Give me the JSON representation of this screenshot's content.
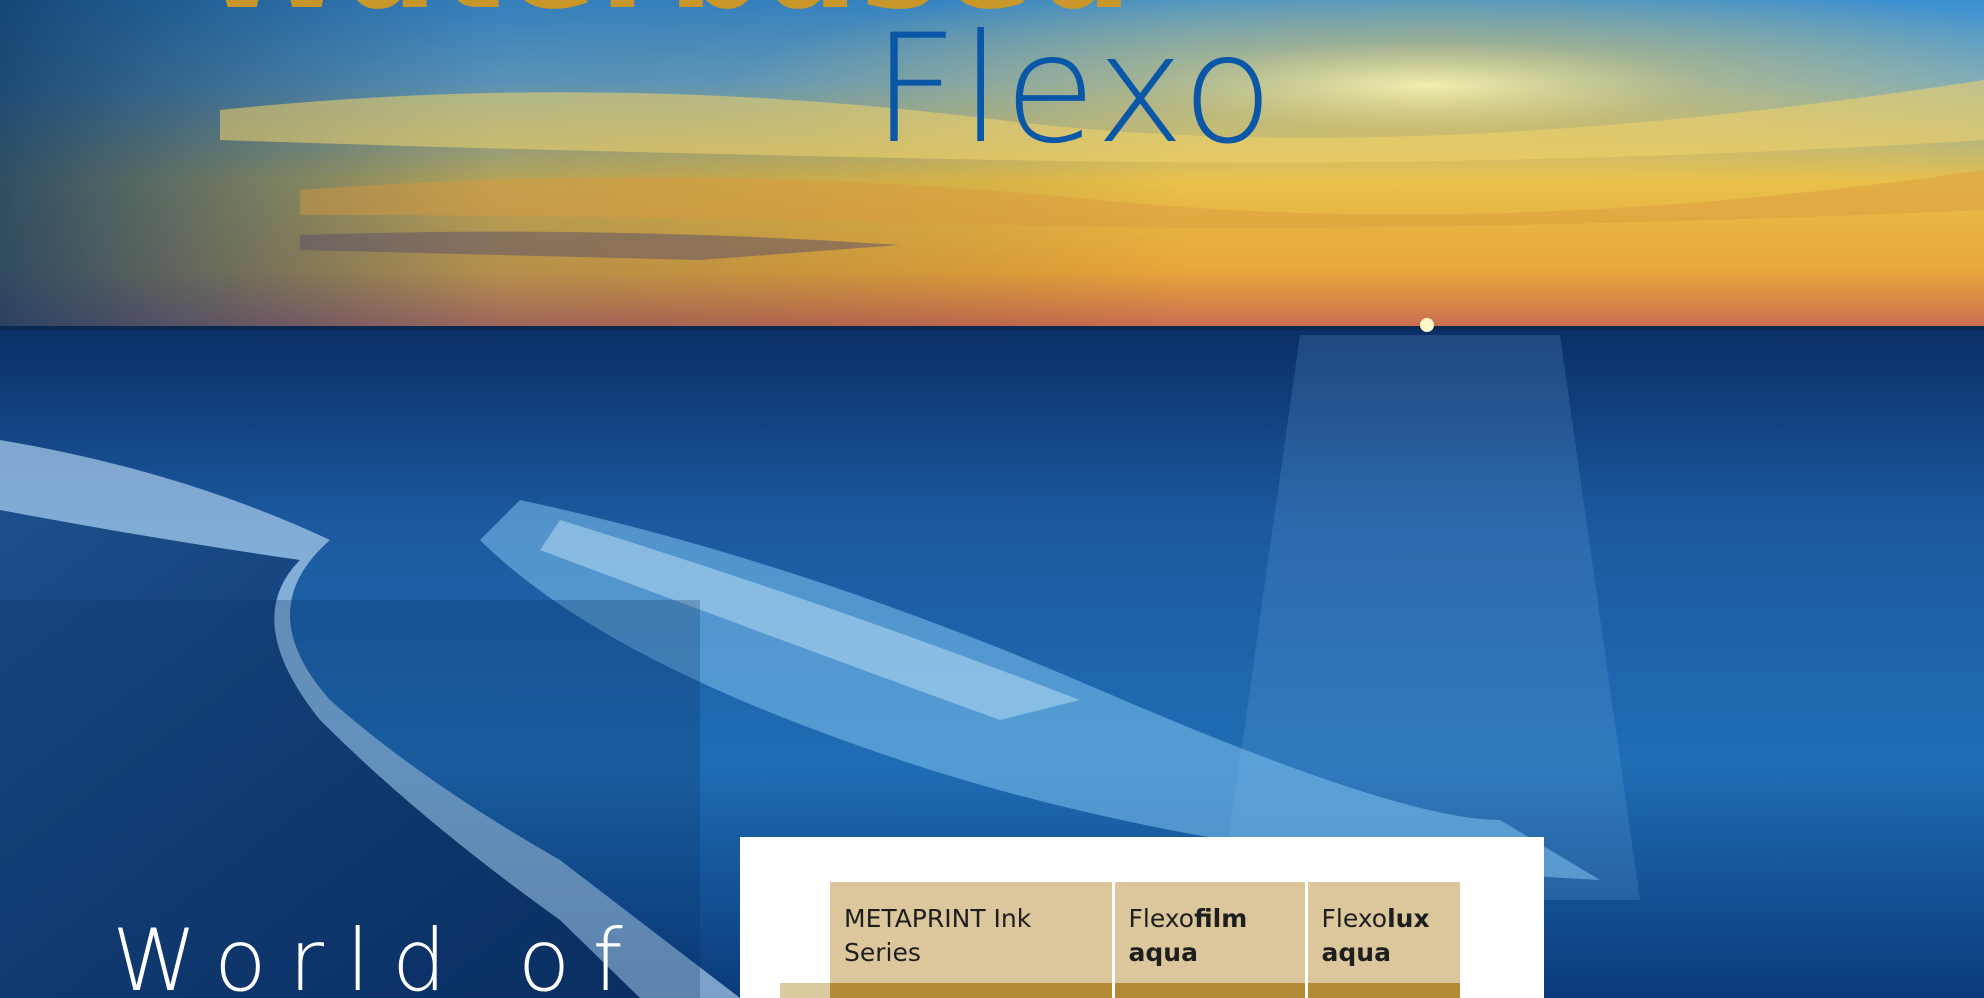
{
  "titles": {
    "top_partial": "Waterbased",
    "main": "Flexo",
    "side": "World of"
  },
  "table": {
    "headers": [
      {
        "prefix": "METAPRINT Ink Series",
        "bold": ""
      },
      {
        "prefix": "Flexo",
        "bold": "film",
        "second_line": "aqua"
      },
      {
        "prefix": "Flexo",
        "bold": "lux",
        "second_line": "aqua"
      }
    ]
  },
  "colors": {
    "gold_title": "#c9962a",
    "blue_title": "#0a57a8",
    "table_header_bg": "#dcc79c",
    "table_row_bg": "#b38a35"
  }
}
